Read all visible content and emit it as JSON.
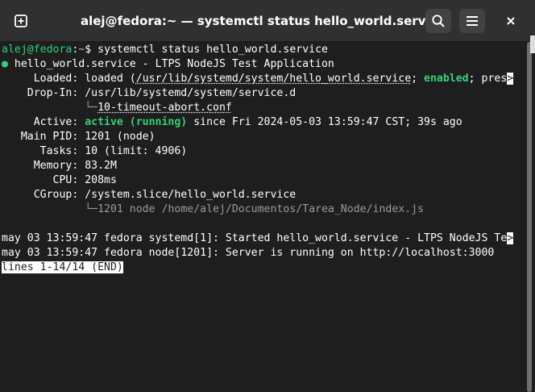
{
  "window": {
    "title": "alej@fedora:~ — systemctl status hello_world.service",
    "buttons": {
      "new_tab_icon": "plus-box-icon",
      "search_icon": "search-icon",
      "menu_icon": "hamburger-menu-icon",
      "close_icon": "close-icon"
    }
  },
  "terminal": {
    "prompt": {
      "user_host": "alej@fedora",
      "sep": ":",
      "path": "~",
      "symbol": "$",
      "command": " systemctl status hello_world.service"
    },
    "status": {
      "bullet": "●",
      "unit_line": " hello_world.service - LTPS NodeJS Test Application",
      "loaded_label": "     Loaded: ",
      "loaded_pre": "loaded (",
      "loaded_path": "/usr/lib/systemd/system/hello_world.service",
      "loaded_sep": "; ",
      "loaded_enabled": "enabled",
      "loaded_post": "; pres",
      "truncation_marker": ">",
      "dropin_label": "    Drop-In: ",
      "dropin_path": "/usr/lib/systemd/system/service.d",
      "dropin_indent": "             ",
      "dropin_tree": "└─",
      "dropin_conf": "10-timeout-abort.conf",
      "active_label": "     Active: ",
      "active_state": "active (running)",
      "active_since": " since Fri 2024-05-03 13:59:47 CST; 39s ago",
      "mainpid": "   Main PID: 1201 (node)",
      "tasks": "      Tasks: 10 (limit: 4906)",
      "memory": "     Memory: 83.2M",
      "cpu": "        CPU: 208ms",
      "cgroup": "     CGroup: /system.slice/hello_world.service",
      "cgroup_indent": "             ",
      "cgroup_tree": "└─",
      "cgroup_proc": "1201 node /home/alej/Documentos/Tarea_Node/index.js"
    },
    "log": {
      "line1": "may 03 13:59:47 fedora systemd[1]: Started hello_world.service - LTPS NodeJS Te",
      "line1_trunc": ">",
      "line2": "may 03 13:59:47 fedora node[1201]: Server is running on http://localhost:3000"
    },
    "pager": "lines 1-14/14 (END)"
  }
}
